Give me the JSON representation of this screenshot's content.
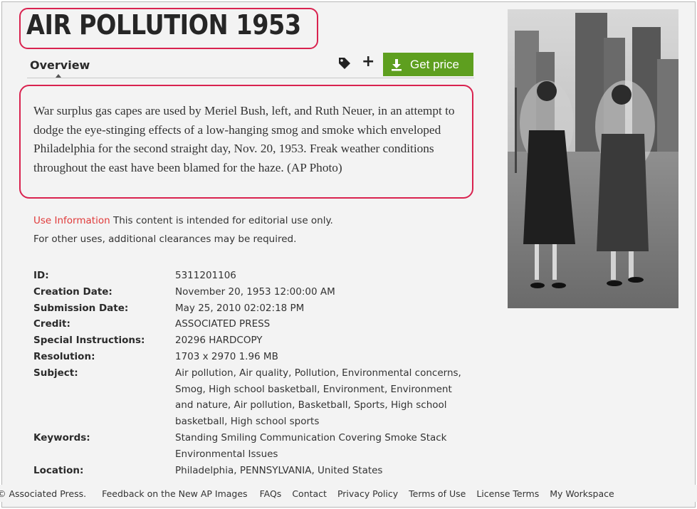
{
  "title": "AIR POLLUTION 1953",
  "tabs": {
    "overview": "Overview"
  },
  "actions": {
    "get_price": "Get price"
  },
  "icons": {
    "tag": "tag-icon",
    "plus": "plus-icon",
    "download": "download-icon"
  },
  "colors": {
    "accent_green": "#5e9f1f",
    "highlight": "#d9224f",
    "link_red": "#e03a3a"
  },
  "description": "War surplus gas capes are used by Meriel Bush, left, and Ruth Neuer, in an attempt to dodge the eye-stinging effects of a low-hanging smog and smoke which enveloped Philadelphia for the second straight day, Nov. 20, 1953. Freak weather conditions throughout the east have been blamed for the haze. (AP Photo)",
  "use_info": {
    "link": "Use Information",
    "line1": " This content is intended for editorial use only.",
    "line2": "For other uses, additional clearances may be required."
  },
  "metadata": [
    {
      "label": "ID:",
      "value": "5311201106"
    },
    {
      "label": "Creation Date:",
      "value": "November 20, 1953 12:00:00 AM"
    },
    {
      "label": "Submission Date:",
      "value": "May 25, 2010 02:02:18 PM"
    },
    {
      "label": "Credit:",
      "value": "ASSOCIATED PRESS"
    },
    {
      "label": "Special Instructions:",
      "value": "20296 HARDCOPY"
    },
    {
      "label": "Resolution:",
      "value": "1703 x 2970 1.96 MB"
    },
    {
      "label": "Subject:",
      "value": "Air pollution, Air quality, Pollution, Environmental concerns, Smog, High school basketball, Environment, Environment and nature, Air pollution, Basketball, Sports, High school basketball, High school sports"
    },
    {
      "label": "Keywords:",
      "value": "Standing Smiling Communication Covering Smoke Stack Environmental Issues"
    },
    {
      "label": "Location:",
      "value": "Philadelphia, PENNSYLVANIA, United States"
    }
  ],
  "footer": {
    "copyright": "© Associated Press.",
    "links": [
      "Feedback on the New AP Images",
      "FAQs",
      "Contact",
      "Privacy Policy",
      "Terms of Use",
      "License Terms",
      "My Workspace"
    ]
  }
}
